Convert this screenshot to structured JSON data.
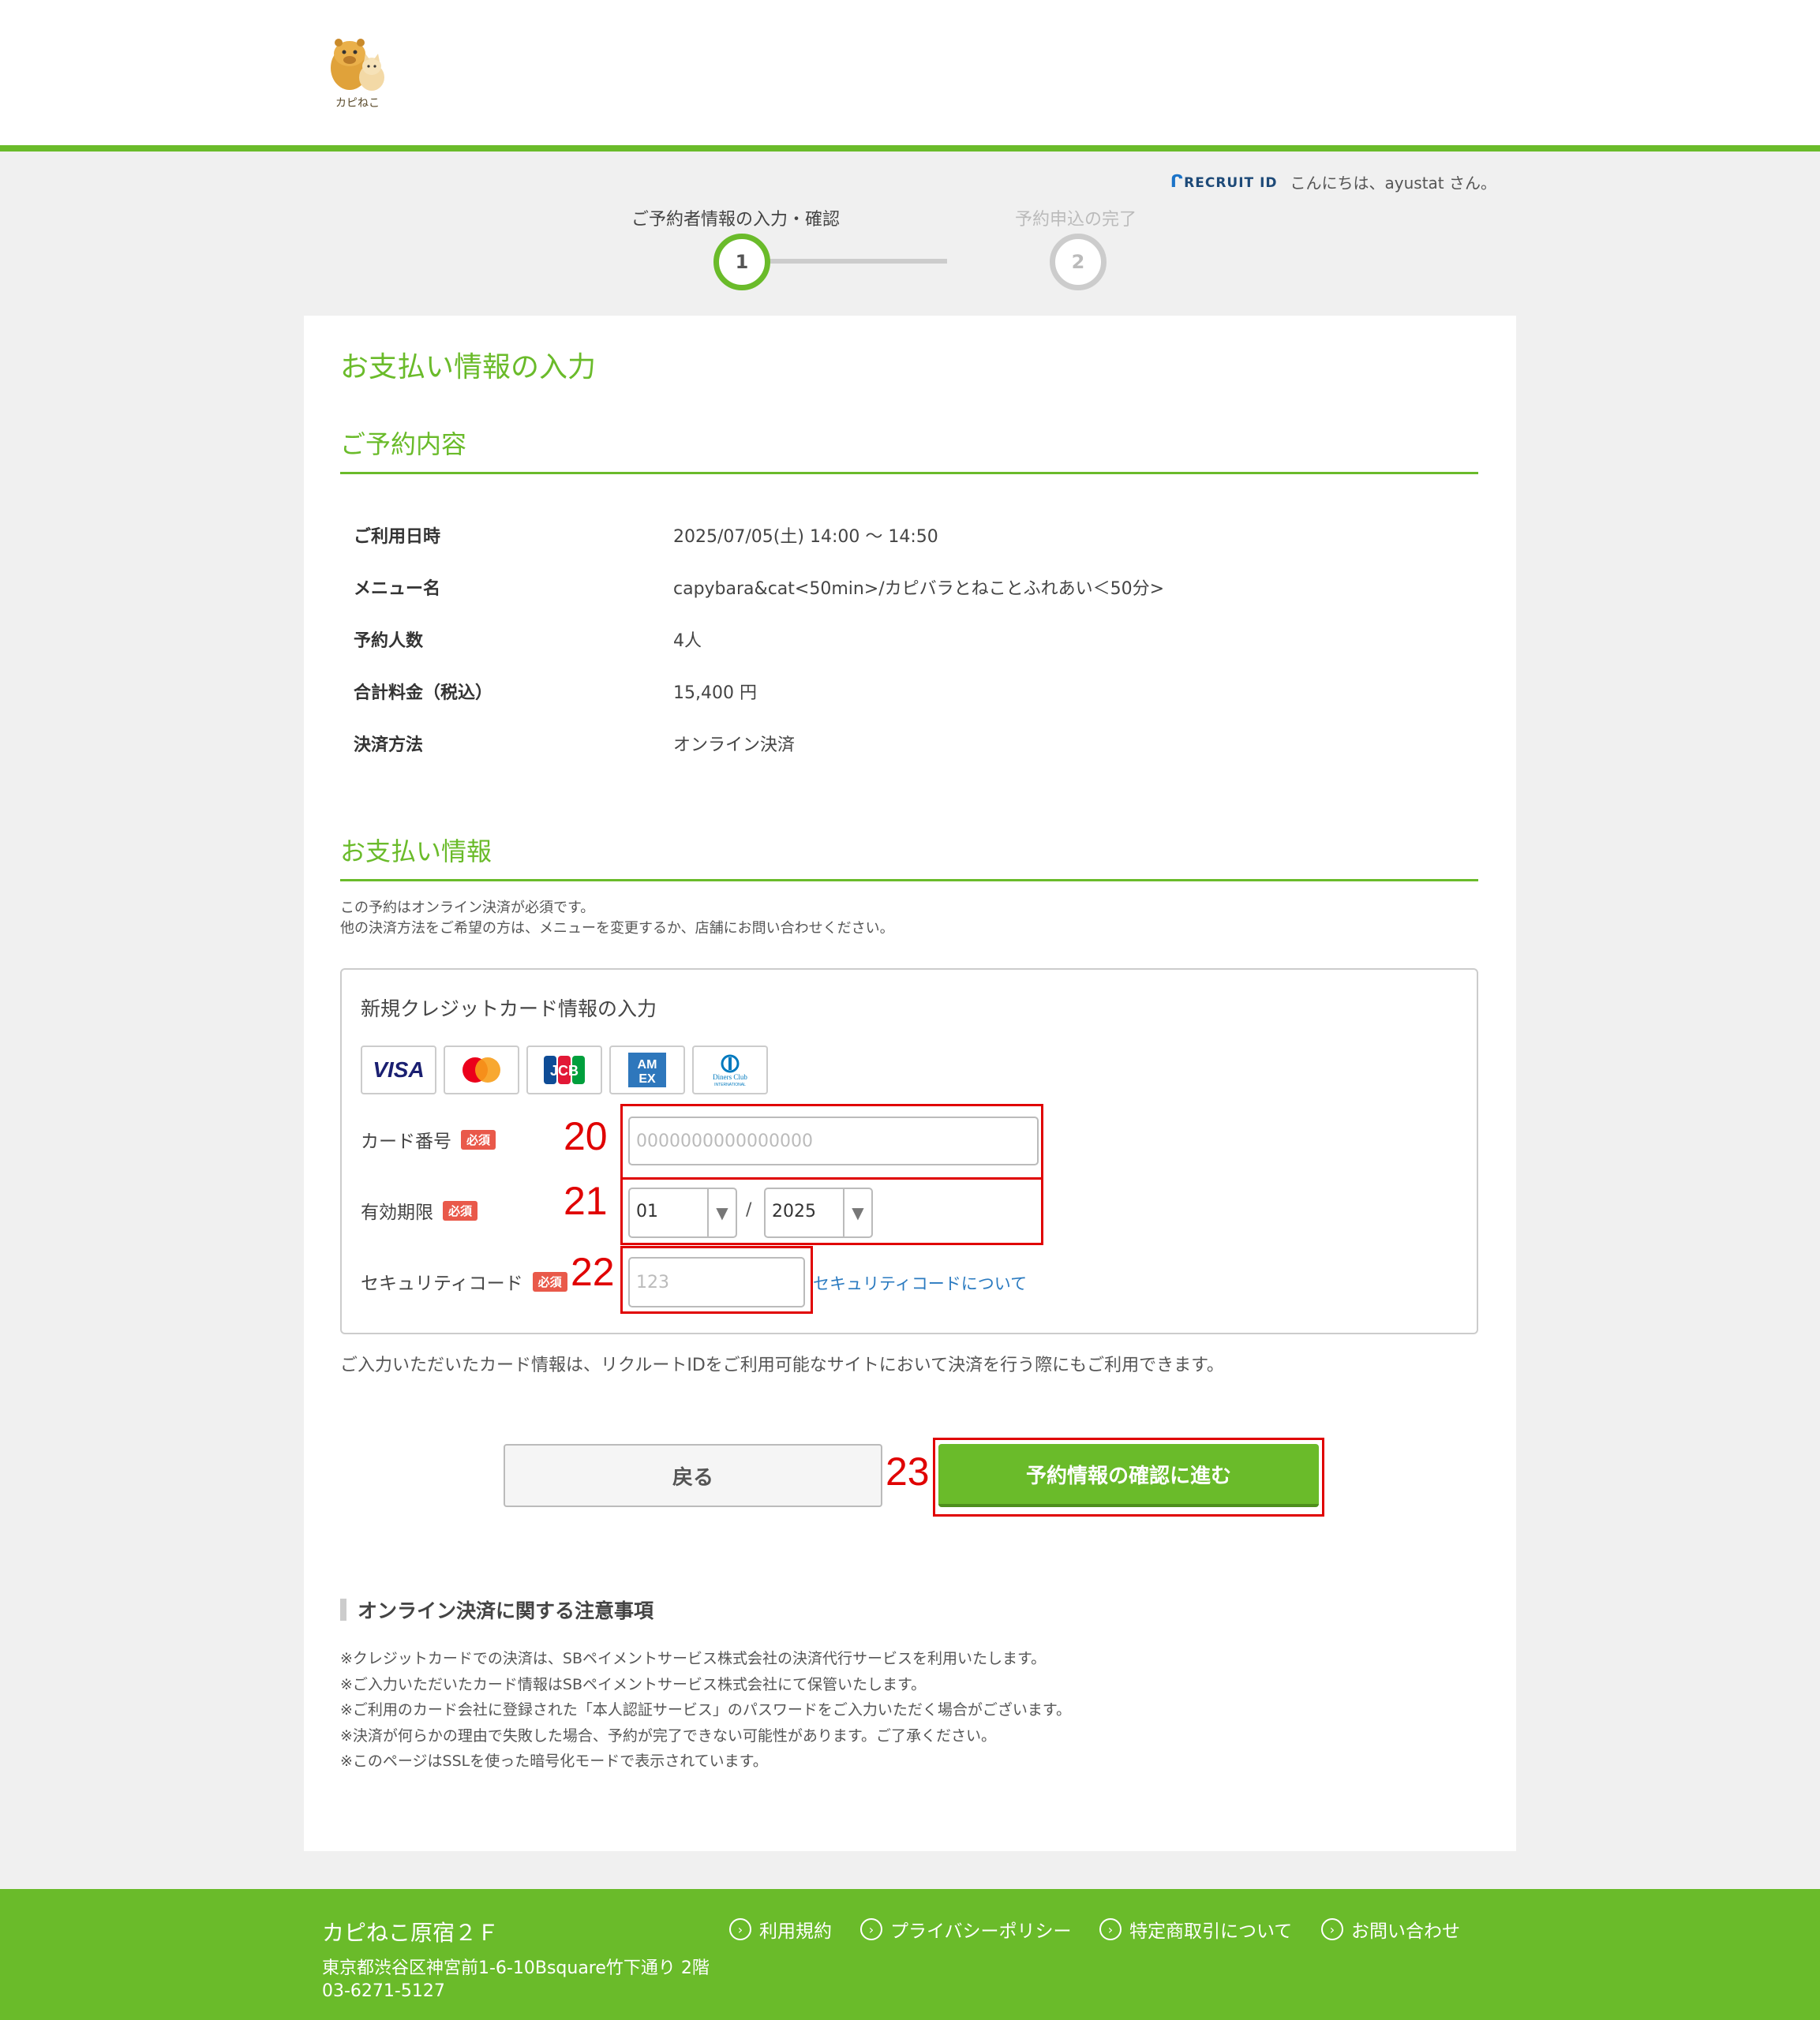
{
  "header": {
    "logo_text": "カピねこ"
  },
  "user": {
    "brand": "RECRUIT ID",
    "greeting": "こんにちは、ayustat さん。"
  },
  "steps": [
    {
      "label": "ご予約者情報の入力・確認",
      "number": "1",
      "active": true
    },
    {
      "label": "予約申込の完了",
      "number": "2",
      "active": false
    }
  ],
  "page_title": "お支払い情報の入力",
  "reservation": {
    "heading": "ご予約内容",
    "rows": [
      {
        "key": "ご利用日時",
        "value": "2025/07/05(土) 14:00 ～ 14:50"
      },
      {
        "key": "メニュー名",
        "value": "capybara&cat<50min>/カピバラとねことふれあい＜50分>"
      },
      {
        "key": "予約人数",
        "value": "4人"
      },
      {
        "key": "合計料金（税込）",
        "value": "15,400 円"
      },
      {
        "key": "決済方法",
        "value": "オンライン決済"
      }
    ]
  },
  "payment": {
    "heading": "お支払い情報",
    "note_line1": "この予約はオンライン決済が必須です。",
    "note_line2": "他の決済方法をご希望の方は、メニューを変更するか、店舗にお問い合わせください。",
    "form_title": "新規クレジットカード情報の入力",
    "brands": [
      "VISA",
      "Mastercard",
      "JCB",
      "AMEX",
      "Diners Club"
    ],
    "required_badge": "必須",
    "card_number": {
      "label": "カード番号",
      "placeholder": "0000000000000000",
      "annotation": "20"
    },
    "expiry": {
      "label": "有効期限",
      "month": "01",
      "separator": "/",
      "year": "2025",
      "annotation": "21"
    },
    "cvc": {
      "label": "セキュリティコード",
      "placeholder": "123",
      "annotation": "22",
      "link": "セキュリティコードについて"
    },
    "save_note": "ご入力いただいたカード情報は、リクルートIDをご利用可能なサイトにおいて決済を行う際にもご利用できます。"
  },
  "buttons": {
    "back": "戻る",
    "next": "予約情報の確認に進む",
    "annotation": "23"
  },
  "notice": {
    "heading": "オンライン決済に関する注意事項",
    "items": [
      "※クレジットカードでの決済は、SBペイメントサービス株式会社の決済代行サービスを利用いたします。",
      "※ご入力いただいたカード情報はSBペイメントサービス株式会社にて保管いたします。",
      "※ご利用のカード会社に登録された「本人認証サービス」のパスワードをご入力いただく場合がございます。",
      "※決済が何らかの理由で失敗した場合、予約が完了できない可能性があります。ご了承ください。",
      "※このページはSSLを使った暗号化モードで表示されています。"
    ]
  },
  "footer": {
    "shop": "カピねこ原宿２Ｆ",
    "address": "東京都渋谷区神宮前1-6-10Bsquare竹下通り 2階",
    "tel": "03-6271-5127",
    "links": [
      "利用規約",
      "プライバシーポリシー",
      "特定商取引について",
      "お問い合わせ"
    ]
  },
  "colors": {
    "accent": "#6abb2a",
    "annotation": "#e00000",
    "required": "#e9594a"
  }
}
